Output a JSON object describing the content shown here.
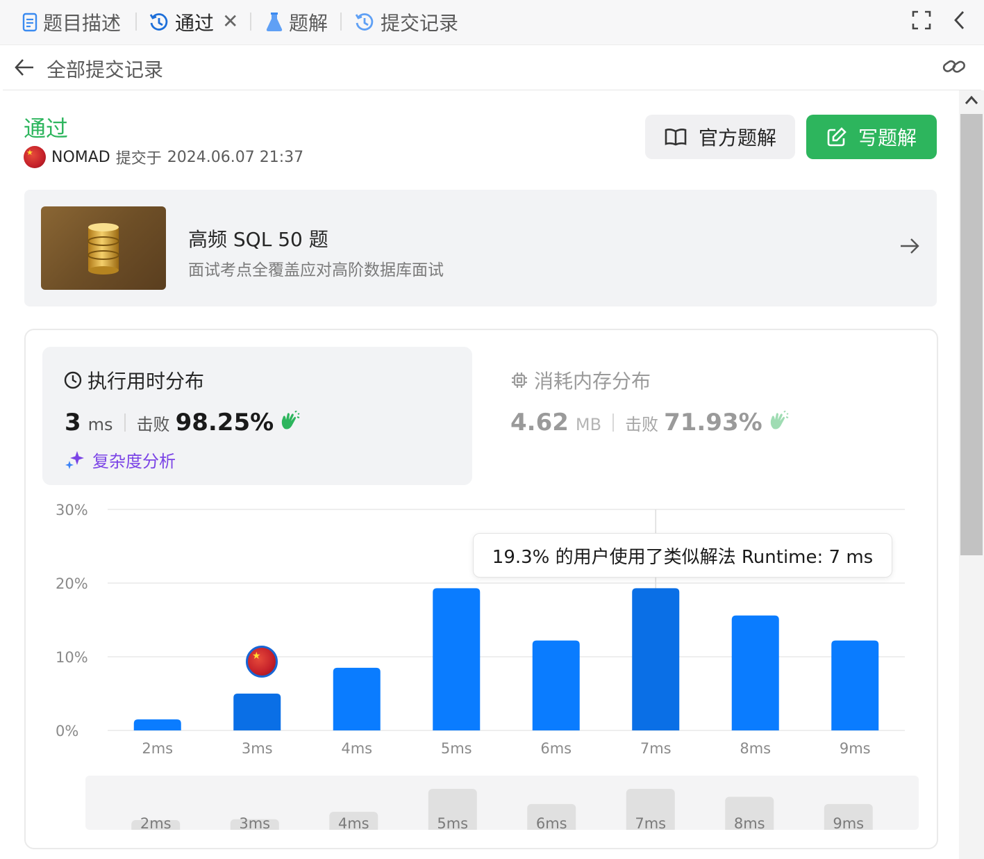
{
  "tabs": [
    {
      "label": "题目描述",
      "icon": "document-icon"
    },
    {
      "label": "通过",
      "icon": "history-icon",
      "active": true,
      "closable": true
    },
    {
      "label": "题解",
      "icon": "flask-icon"
    },
    {
      "label": "提交记录",
      "icon": "history-icon"
    }
  ],
  "header": {
    "title": "全部提交记录"
  },
  "submission": {
    "status": "通过",
    "user": "NOMAD",
    "submitted_prefix": "提交于",
    "datetime": "2024.06.07 21:37"
  },
  "buttons": {
    "official": "官方题解",
    "write": "写题解"
  },
  "plan": {
    "title": "高频 SQL 50 题",
    "subtitle": "面试考点全覆盖应对高阶数据库面试"
  },
  "runtime": {
    "heading": "执行用时分布",
    "value": "3",
    "unit": "ms",
    "beat_label": "击败",
    "beat": "98.25%",
    "complexity": "复杂度分析"
  },
  "memory": {
    "heading": "消耗内存分布",
    "value": "4.62",
    "unit": "MB",
    "beat_label": "击败",
    "beat": "71.93%"
  },
  "tooltip": "19.3% 的用户使用了类似解法 Runtime: 7 ms",
  "colors": {
    "accent_green": "#2db55d",
    "bar": "#0a7cff",
    "bar_highlight": "#0a6fe6",
    "complexity": "#7b44e6"
  },
  "chart_data": {
    "type": "bar",
    "categories": [
      "2ms",
      "3ms",
      "4ms",
      "5ms",
      "6ms",
      "7ms",
      "8ms",
      "9ms"
    ],
    "values": [
      1.5,
      5.0,
      8.5,
      19.3,
      12.2,
      19.3,
      15.6,
      12.2
    ],
    "ylim": [
      0,
      30
    ],
    "yticks": [
      "0%",
      "10%",
      "20%",
      "30%"
    ],
    "highlighted": [
      "3ms",
      "7ms"
    ],
    "grid": true
  },
  "mini_overview": {
    "labels": [
      "2ms",
      "3ms",
      "4ms",
      "5ms",
      "6ms",
      "7ms",
      "8ms",
      "9ms"
    ]
  }
}
